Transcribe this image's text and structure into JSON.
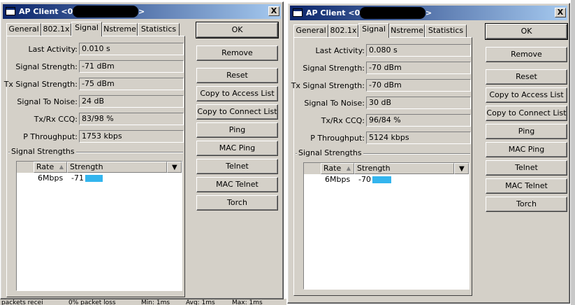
{
  "windows": [
    {
      "title": "AP Client <0",
      "title_suffix": ">",
      "close_label": "X",
      "tabs": [
        "General",
        "802.1x",
        "Signal",
        "Nstreme",
        "Statistics"
      ],
      "active_tab": "Signal",
      "fields": [
        {
          "label": "Last Activity:",
          "value": "0.010 s"
        },
        {
          "label": "Signal Strength:",
          "value": "-71 dBm"
        },
        {
          "label": "Tx Signal Strength:",
          "value": "-75 dBm"
        },
        {
          "label": "Signal To Noise:",
          "value": "24 dB"
        },
        {
          "label": "Tx/Rx CCQ:",
          "value": "83/98 %"
        },
        {
          "label": "P Throughput:",
          "value": "1753 kbps"
        }
      ],
      "group_title": "Signal Strengths",
      "list_columns": [
        "Rate",
        "Strength"
      ],
      "list_rows": [
        {
          "rate": "6Mbps",
          "strength": "-71",
          "level": 0.18
        }
      ],
      "buttons": [
        "OK",
        "Remove",
        "Reset",
        "Copy to Access List",
        "Copy to Connect List",
        "Ping",
        "MAC Ping",
        "Telnet",
        "MAC Telnet",
        "Torch"
      ]
    },
    {
      "title": "AP Client <0",
      "title_suffix": ">",
      "close_label": "X",
      "tabs": [
        "General",
        "802.1x",
        "Signal",
        "Nstreme",
        "Statistics"
      ],
      "active_tab": "Signal",
      "fields": [
        {
          "label": "Last Activity:",
          "value": "0.080 s"
        },
        {
          "label": "Signal Strength:",
          "value": "-70 dBm"
        },
        {
          "label": "Tx Signal Strength:",
          "value": "-70 dBm"
        },
        {
          "label": "Signal To Noise:",
          "value": "30 dB"
        },
        {
          "label": "Tx/Rx CCQ:",
          "value": "96/84 %"
        },
        {
          "label": "P Throughput:",
          "value": "5124 kbps"
        }
      ],
      "group_title": "Signal Strengths",
      "list_columns": [
        "Rate",
        "Strength"
      ],
      "list_rows": [
        {
          "rate": "6Mbps",
          "strength": "-70",
          "level": 0.19
        }
      ],
      "buttons": [
        "OK",
        "Remove",
        "Reset",
        "Copy to Access List",
        "Copy to Connect List",
        "Ping",
        "MAC Ping",
        "Telnet",
        "MAC Telnet",
        "Torch"
      ]
    }
  ],
  "background_status": [
    "packets recei",
    "0% packet loss",
    "Min: 1ms",
    "Avg: 1ms",
    "Max: 1ms"
  ],
  "icons": {
    "close": "close-icon",
    "window": "window-icon",
    "sort": "sort-up-icon",
    "menu": "dropdown-arrow-icon"
  },
  "colors": {
    "title_bar": "#0a246a",
    "face": "#d4d0c8",
    "signal_bar": "#33b5ee"
  }
}
